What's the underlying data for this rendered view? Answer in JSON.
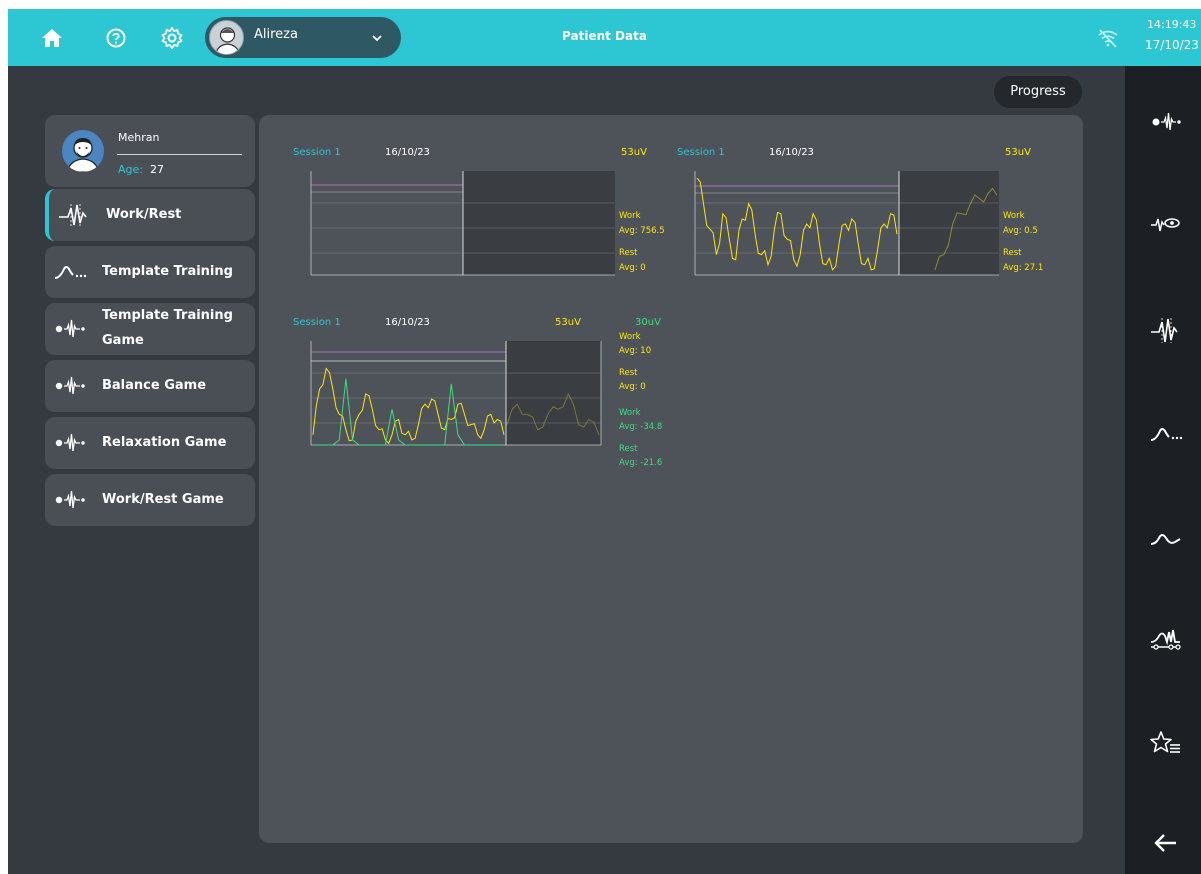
{
  "topbar": {
    "title": "Patient Data",
    "user_name": "Alireza",
    "time": "14:19:43",
    "date": "17/10/23",
    "accent": "#2cc7d3"
  },
  "icons": {
    "home": "home-icon",
    "help": "help-icon",
    "settings": "gear-icon",
    "dropdown": "chevron-down-icon",
    "wifi": "wifi-off-icon",
    "back": "back-arrow-icon"
  },
  "profile": {
    "name": "Mehran",
    "age_label": "Age:",
    "age": "27"
  },
  "progress_label": "Progress",
  "menu": [
    {
      "label": "Work/Rest",
      "icon": "emg-signal-icon",
      "active": true
    },
    {
      "label": "Template Training",
      "icon": "template-curve-icon",
      "active": false
    },
    {
      "label": "Template Training Game",
      "label_line1": "Template Training",
      "label_line2": "Game",
      "icon": "game-signal-icon",
      "active": false
    },
    {
      "label": "Balance Game",
      "icon": "game-signal-icon",
      "active": false
    },
    {
      "label": "Relaxation Game",
      "icon": "game-signal-icon",
      "active": false
    },
    {
      "label": "Work/Rest Game",
      "icon": "game-signal-icon",
      "active": false
    }
  ],
  "rail": [
    "game-signal-icon",
    "signal-eye-icon",
    "emg-signal-icon",
    "template-curve-icon",
    "wave-curve-icon",
    "multi-channel-icon",
    "star-list-icon",
    "back-arrow-icon"
  ],
  "sessions": [
    {
      "session": "Session 1",
      "date": "16/10/23",
      "amplitude": "53uV",
      "legend": {
        "work": "Work",
        "work_avg": "Avg: 756.5",
        "rest": "Rest",
        "rest_avg": "Avg: 0"
      }
    },
    {
      "session": "Session 1",
      "date": "16/10/23",
      "amplitude": "53uV",
      "legend": {
        "work": "Work",
        "work_avg": "Avg: 0.5",
        "rest": "Rest",
        "rest_avg": "Avg: 27.1"
      }
    },
    {
      "session": "Session 1",
      "date": "16/10/23",
      "amplitude": "53uV",
      "amplitude2": "30uV",
      "legend": {
        "work": "Work",
        "work_avg": "Avg: 10",
        "rest": "Rest",
        "rest_avg": "Avg: 0",
        "work2": "Work",
        "work2_avg": "Avg: -34.8",
        "rest2": "Rest",
        "rest2_avg": "Avg: -21.6"
      }
    }
  ],
  "chart_data": [
    {
      "type": "line",
      "series": [
        {
          "values": []
        }
      ],
      "note_work_avg": 756.5,
      "note_rest_avg": 0,
      "grid": true
    },
    {
      "type": "line",
      "series": [
        {
          "values": [
            0.95,
            0.7,
            0.45,
            0.2,
            0.6,
            0.35,
            0.15,
            0.55,
            0.7,
            0.4,
            0.2,
            0.1,
            0.45,
            0.6,
            0.35,
            0.15,
            0.2,
            0.5,
            0.6,
            0.3,
            0.1,
            0.05,
            0.3,
            0.5,
            0.55,
            0.3,
            0.1,
            0.05,
            0.25,
            0.5,
            0.6,
            0.4
          ]
        }
      ],
      "grid": true
    },
    {
      "type": "line",
      "series": [
        {
          "values": [
            0.1,
            0.55,
            0.75,
            0.55,
            0.3,
            0.15,
            0.05,
            0.3,
            0.5,
            0.35,
            0.15,
            0.05,
            0.1,
            0.25,
            0.1,
            0.05,
            0.2,
            0.4,
            0.45,
            0.3,
            0.15,
            0.25,
            0.4,
            0.3,
            0.2,
            0.1,
            0.15,
            0.3,
            0.25,
            0.1
          ]
        },
        {
          "values": [
            0.0,
            0.0,
            0.0,
            0.0,
            0.05,
            0.65,
            0.05,
            0.0,
            0.0,
            0.0,
            0.0,
            0.0,
            0.35,
            0.05,
            0.0,
            0.0,
            0.0,
            0.0,
            0.0,
            0.0,
            0.0,
            0.6,
            0.1,
            0.0,
            0.0,
            0.0,
            0.0,
            0.0,
            0.0,
            0.0
          ]
        }
      ],
      "grid": true
    }
  ]
}
